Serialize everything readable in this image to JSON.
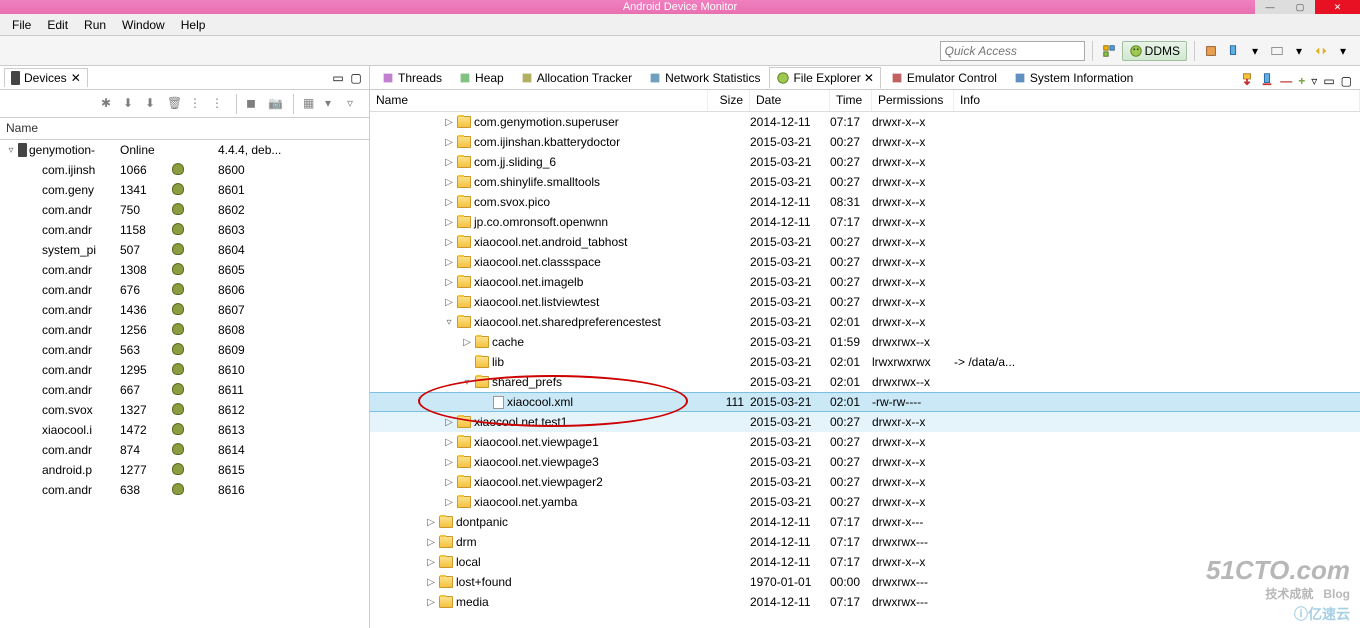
{
  "window": {
    "title": "Android Device Monitor"
  },
  "menu": [
    "File",
    "Edit",
    "Run",
    "Window",
    "Help"
  ],
  "toolbar": {
    "quick_access": "Quick Access",
    "ddms": "DDMS"
  },
  "devices": {
    "tab": "Devices",
    "header": "Name",
    "root": {
      "name": "genymotion-",
      "status": "Online",
      "ver": "4.4.4, deb..."
    },
    "procs": [
      {
        "name": "com.ijinsh",
        "pid": "1066",
        "port": "8600"
      },
      {
        "name": "com.geny",
        "pid": "1341",
        "port": "8601"
      },
      {
        "name": "com.andr",
        "pid": "750",
        "port": "8602"
      },
      {
        "name": "com.andr",
        "pid": "1158",
        "port": "8603"
      },
      {
        "name": "system_pi",
        "pid": "507",
        "port": "8604"
      },
      {
        "name": "com.andr",
        "pid": "1308",
        "port": "8605"
      },
      {
        "name": "com.andr",
        "pid": "676",
        "port": "8606"
      },
      {
        "name": "com.andr",
        "pid": "1436",
        "port": "8607"
      },
      {
        "name": "com.andr",
        "pid": "1256",
        "port": "8608"
      },
      {
        "name": "com.andr",
        "pid": "563",
        "port": "8609"
      },
      {
        "name": "com.andr",
        "pid": "1295",
        "port": "8610"
      },
      {
        "name": "com.andr",
        "pid": "667",
        "port": "8611"
      },
      {
        "name": "com.svox",
        "pid": "1327",
        "port": "8612"
      },
      {
        "name": "xiaocool.i",
        "pid": "1472",
        "port": "8613"
      },
      {
        "name": "com.andr",
        "pid": "874",
        "port": "8614"
      },
      {
        "name": "android.p",
        "pid": "1277",
        "port": "8615"
      },
      {
        "name": "com.andr",
        "pid": "638",
        "port": "8616"
      }
    ]
  },
  "tabs": [
    "Threads",
    "Heap",
    "Allocation Tracker",
    "Network Statistics",
    "File Explorer",
    "Emulator Control",
    "System Information"
  ],
  "fileheaders": {
    "name": "Name",
    "size": "Size",
    "date": "Date",
    "time": "Time",
    "perm": "Permissions",
    "info": "Info"
  },
  "files": [
    {
      "ind": 3,
      "tw": "▷",
      "icon": "folder",
      "name": "com.genymotion.superuser",
      "size": "",
      "date": "2014-12-11",
      "time": "07:17",
      "perm": "drwxr-x--x",
      "info": ""
    },
    {
      "ind": 3,
      "tw": "▷",
      "icon": "folder",
      "name": "com.ijinshan.kbatterydoctor",
      "size": "",
      "date": "2015-03-21",
      "time": "00:27",
      "perm": "drwxr-x--x",
      "info": ""
    },
    {
      "ind": 3,
      "tw": "▷",
      "icon": "folder",
      "name": "com.jj.sliding_6",
      "size": "",
      "date": "2015-03-21",
      "time": "00:27",
      "perm": "drwxr-x--x",
      "info": ""
    },
    {
      "ind": 3,
      "tw": "▷",
      "icon": "folder",
      "name": "com.shinylife.smalltools",
      "size": "",
      "date": "2015-03-21",
      "time": "00:27",
      "perm": "drwxr-x--x",
      "info": ""
    },
    {
      "ind": 3,
      "tw": "▷",
      "icon": "folder",
      "name": "com.svox.pico",
      "size": "",
      "date": "2014-12-11",
      "time": "08:31",
      "perm": "drwxr-x--x",
      "info": ""
    },
    {
      "ind": 3,
      "tw": "▷",
      "icon": "folder",
      "name": "jp.co.omronsoft.openwnn",
      "size": "",
      "date": "2014-12-11",
      "time": "07:17",
      "perm": "drwxr-x--x",
      "info": ""
    },
    {
      "ind": 3,
      "tw": "▷",
      "icon": "folder",
      "name": "xiaocool.net.android_tabhost",
      "size": "",
      "date": "2015-03-21",
      "time": "00:27",
      "perm": "drwxr-x--x",
      "info": ""
    },
    {
      "ind": 3,
      "tw": "▷",
      "icon": "folder",
      "name": "xiaocool.net.classspace",
      "size": "",
      "date": "2015-03-21",
      "time": "00:27",
      "perm": "drwxr-x--x",
      "info": ""
    },
    {
      "ind": 3,
      "tw": "▷",
      "icon": "folder",
      "name": "xiaocool.net.imagelb",
      "size": "",
      "date": "2015-03-21",
      "time": "00:27",
      "perm": "drwxr-x--x",
      "info": ""
    },
    {
      "ind": 3,
      "tw": "▷",
      "icon": "folder",
      "name": "xiaocool.net.listviewtest",
      "size": "",
      "date": "2015-03-21",
      "time": "00:27",
      "perm": "drwxr-x--x",
      "info": ""
    },
    {
      "ind": 3,
      "tw": "▿",
      "icon": "folder",
      "name": "xiaocool.net.sharedpreferencestest",
      "size": "",
      "date": "2015-03-21",
      "time": "02:01",
      "perm": "drwxr-x--x",
      "info": ""
    },
    {
      "ind": 4,
      "tw": "▷",
      "icon": "folder",
      "name": "cache",
      "size": "",
      "date": "2015-03-21",
      "time": "01:59",
      "perm": "drwxrwx--x",
      "info": ""
    },
    {
      "ind": 4,
      "tw": "",
      "icon": "folder",
      "name": "lib",
      "size": "",
      "date": "2015-03-21",
      "time": "02:01",
      "perm": "lrwxrwxrwx",
      "info": "-> /data/a..."
    },
    {
      "ind": 4,
      "tw": "▿",
      "icon": "folder",
      "name": "shared_prefs",
      "size": "",
      "date": "2015-03-21",
      "time": "02:01",
      "perm": "drwxrwx--x",
      "info": ""
    },
    {
      "ind": 5,
      "tw": "",
      "icon": "file",
      "name": "xiaocool.xml",
      "size": "111",
      "date": "2015-03-21",
      "time": "02:01",
      "perm": "-rw-rw----",
      "info": "",
      "sel": true
    },
    {
      "ind": 3,
      "tw": "▷",
      "icon": "folder",
      "name": "xiaocool.net.test1",
      "size": "",
      "date": "2015-03-21",
      "time": "00:27",
      "perm": "drwxr-x--x",
      "info": "",
      "hl": true
    },
    {
      "ind": 3,
      "tw": "▷",
      "icon": "folder",
      "name": "xiaocool.net.viewpage1",
      "size": "",
      "date": "2015-03-21",
      "time": "00:27",
      "perm": "drwxr-x--x",
      "info": ""
    },
    {
      "ind": 3,
      "tw": "▷",
      "icon": "folder",
      "name": "xiaocool.net.viewpage3",
      "size": "",
      "date": "2015-03-21",
      "time": "00:27",
      "perm": "drwxr-x--x",
      "info": ""
    },
    {
      "ind": 3,
      "tw": "▷",
      "icon": "folder",
      "name": "xiaocool.net.viewpager2",
      "size": "",
      "date": "2015-03-21",
      "time": "00:27",
      "perm": "drwxr-x--x",
      "info": ""
    },
    {
      "ind": 3,
      "tw": "▷",
      "icon": "folder",
      "name": "xiaocool.net.yamba",
      "size": "",
      "date": "2015-03-21",
      "time": "00:27",
      "perm": "drwxr-x--x",
      "info": ""
    },
    {
      "ind": 2,
      "tw": "▷",
      "icon": "folder",
      "name": "dontpanic",
      "size": "",
      "date": "2014-12-11",
      "time": "07:17",
      "perm": "drwxr-x---",
      "info": ""
    },
    {
      "ind": 2,
      "tw": "▷",
      "icon": "folder",
      "name": "drm",
      "size": "",
      "date": "2014-12-11",
      "time": "07:17",
      "perm": "drwxrwx---",
      "info": ""
    },
    {
      "ind": 2,
      "tw": "▷",
      "icon": "folder",
      "name": "local",
      "size": "",
      "date": "2014-12-11",
      "time": "07:17",
      "perm": "drwxr-x--x",
      "info": ""
    },
    {
      "ind": 2,
      "tw": "▷",
      "icon": "folder",
      "name": "lost+found",
      "size": "",
      "date": "1970-01-01",
      "time": "00:00",
      "perm": "drwxrwx---",
      "info": ""
    },
    {
      "ind": 2,
      "tw": "▷",
      "icon": "folder",
      "name": "media",
      "size": "",
      "date": "2014-12-11",
      "time": "07:17",
      "perm": "drwxrwx---",
      "info": ""
    }
  ]
}
